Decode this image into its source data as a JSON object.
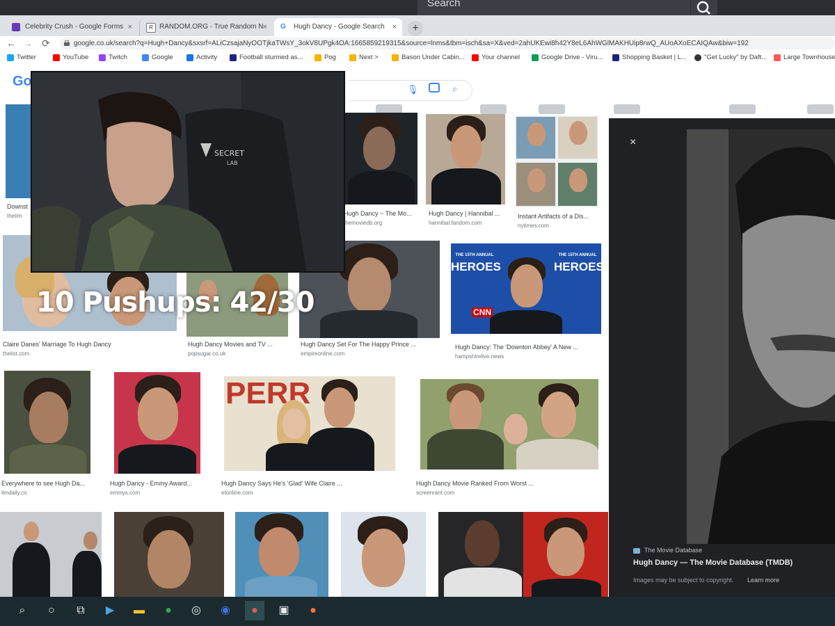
{
  "desktop_search": {
    "text": "Search"
  },
  "tabs": [
    {
      "label": "Celebrity Crush - Google Forms",
      "color": "#673ab7",
      "active": false
    },
    {
      "label": "RANDOM.ORG - True Random N",
      "color": "#ffffff",
      "active": false
    },
    {
      "label": "Hugh Dancy - Google Search",
      "color": "#4285f4",
      "active": true
    }
  ],
  "new_tab_label": "+",
  "address": "google.co.uk/search?q=Hugh+Dancy&sxsrf=ALiCzsajaNyOOTjkaTWsY_3okV8UPgk4OA:1665859219315&source=lnms&tbm=isch&sa=X&ved=2ahUKEwi8h42Y8eL6AhWGlMAKHUip8rwQ_AUoAXoECAIQAw&biw=192",
  "bookmarks": [
    {
      "label": "Twitter",
      "color": "#1da1f2"
    },
    {
      "label": "YouTube",
      "color": "#ff0000"
    },
    {
      "label": "Twitch",
      "color": "#9146ff"
    },
    {
      "label": "Google",
      "color": "#4285f4"
    },
    {
      "label": "Activity",
      "color": "#1a73e8"
    },
    {
      "label": "Football sturmed as...",
      "color": "#1a237e"
    },
    {
      "label": "Pog",
      "color": "#f4b400"
    },
    {
      "label": "Next >",
      "color": "#f4b400"
    },
    {
      "label": "Bason Under Cabin...",
      "color": "#f4b400"
    },
    {
      "label": "Your channel",
      "color": "#ff0000"
    },
    {
      "label": "Google Drive - Viru...",
      "color": "#0f9d58"
    },
    {
      "label": "Shopping Basket | L...",
      "color": "#1a237e"
    },
    {
      "label": "\"Get Lucky\" by Daft...",
      "color": "#333333"
    },
    {
      "label": "Large Townhouse",
      "color": "#ff5a5f"
    }
  ],
  "google_logo": "Go",
  "webcam_overlay": {
    "counter": "10 Pushups: 42/30"
  },
  "results": [
    {
      "caption": "Downst",
      "source": "thetim"
    },
    {
      "caption": "Hugh Dancy ~ The Mo...",
      "source": "themoviedb.org"
    },
    {
      "caption": "Hugh Dancy | Hannibal ...",
      "source": "hannibal.fandom.com"
    },
    {
      "caption": "Instant Artifacts of a Dis...",
      "source": "nytimes.com"
    },
    {
      "caption": "Claire Danes' Marriage To Hugh Dancy",
      "source": "thelist.com"
    },
    {
      "caption": "Hugh Dancy Movies and TV ...",
      "source": "popsugar.co.uk"
    },
    {
      "caption": "Hugh Dancy Set For The Happy Prince ...",
      "source": "empireonline.com"
    },
    {
      "caption": "Hugh Dancy: The 'Downton Abbey' A New ...",
      "source": "hampshirelive.news"
    },
    {
      "caption": "Everywhere to see Hugh Da...",
      "source": "ilmdaily.co"
    },
    {
      "caption": "Hugh Dancy - Emmy Award...",
      "source": "emmys.com"
    },
    {
      "caption": "Hugh Dancy Says He's 'Glad' Wife Claire ...",
      "source": "etonline.com"
    },
    {
      "caption": "Hugh Dancy Movie Ranked From Worst ...",
      "source": "screenrant.com"
    }
  ],
  "cnn_banner": {
    "line1": "THE 15TH ANNUAL",
    "line2": "HEROES",
    "line3": "CNN"
  },
  "perr_text": "PERR",
  "side_panel": {
    "close": "×",
    "source": "The Movie Database",
    "title": "Hugh Dancy — The Movie Database (TMDB)",
    "copyright": "Images may be subject to copyright.",
    "learn_more": "Learn more"
  },
  "colors": {
    "accent": "#4285f4",
    "panel": "#202124",
    "taskbar": "#1b2a2e"
  }
}
